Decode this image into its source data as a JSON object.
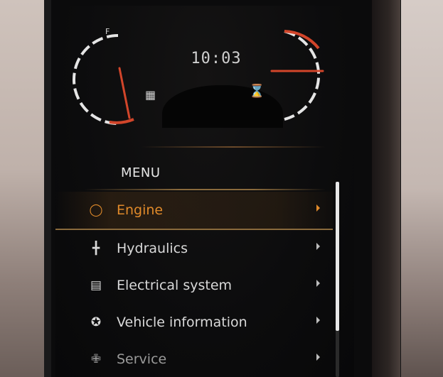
{
  "display": {
    "clock": "10:03",
    "fuel_gauge": {
      "label_full": "F",
      "level_fraction": 0.2,
      "icon": "fuel-pump-icon"
    },
    "temp_gauge": {
      "level_fraction": 0.45,
      "icon": "oil-temperature-icon"
    }
  },
  "menu": {
    "title": "MENU",
    "items": [
      {
        "label": "Engine",
        "icon": "engine-oil-drop-icon",
        "selected": true
      },
      {
        "label": "Hydraulics",
        "icon": "hydraulics-icon",
        "selected": false
      },
      {
        "label": "Electrical system",
        "icon": "battery-icon",
        "selected": false
      },
      {
        "label": "Vehicle information",
        "icon": "vehicle-info-icon",
        "selected": false
      },
      {
        "label": "Service",
        "icon": "service-icon",
        "selected": false
      }
    ]
  },
  "colors": {
    "accent": "#e08a2a",
    "needle": "#d2452a",
    "text": "#d9d9d9",
    "screen_bg": "#0c0c0d"
  }
}
